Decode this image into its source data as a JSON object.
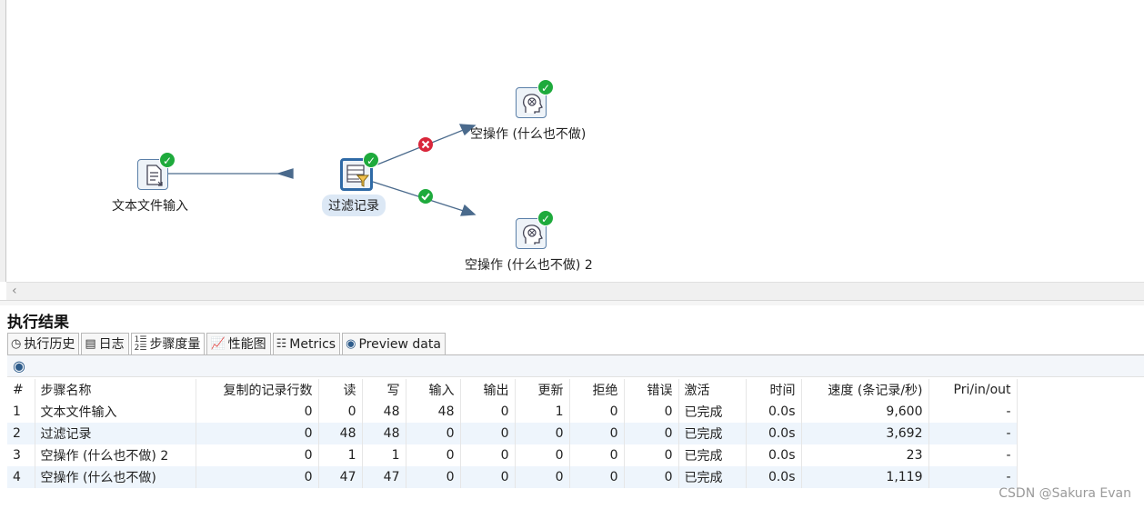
{
  "canvas": {
    "steps": [
      {
        "label": "文本文件输入",
        "status": "ok"
      },
      {
        "label": "过滤记录",
        "status": "ok"
      },
      {
        "label": "空操作 (什么也不做)",
        "status": "ok"
      },
      {
        "label": "空操作 (什么也不做) 2",
        "status": "ok"
      }
    ],
    "hops": [
      {
        "from": "文本文件输入",
        "to": "过滤记录",
        "type": "normal"
      },
      {
        "from": "过滤记录",
        "to": "空操作 (什么也不做)",
        "type": "false"
      },
      {
        "from": "过滤记录",
        "to": "空操作 (什么也不做) 2",
        "type": "true"
      }
    ]
  },
  "results": {
    "title": "执行结果",
    "tabs": [
      "执行历史",
      "日志",
      "步骤度量",
      "性能图",
      "Metrics",
      "Preview data"
    ],
    "active_tab": "步骤度量",
    "columns": [
      "#",
      "步骤名称",
      "复制的记录行数",
      "读",
      "写",
      "输入",
      "输出",
      "更新",
      "拒绝",
      "错误",
      "激活",
      "时间",
      "速度 (条记录/秒)",
      "Pri/in/out"
    ],
    "rows": [
      [
        "1",
        "文本文件输入",
        "0",
        "0",
        "48",
        "48",
        "0",
        "1",
        "0",
        "0",
        "已完成",
        "0.0s",
        "9,600",
        "-"
      ],
      [
        "2",
        "过滤记录",
        "0",
        "48",
        "48",
        "0",
        "0",
        "0",
        "0",
        "0",
        "已完成",
        "0.0s",
        "3,692",
        "-"
      ],
      [
        "3",
        "空操作 (什么也不做) 2",
        "0",
        "1",
        "1",
        "0",
        "0",
        "0",
        "0",
        "0",
        "已完成",
        "0.0s",
        "23",
        "-"
      ],
      [
        "4",
        "空操作 (什么也不做)",
        "0",
        "47",
        "47",
        "0",
        "0",
        "0",
        "0",
        "0",
        "已完成",
        "0.0s",
        "1,119",
        "-"
      ]
    ]
  },
  "watermark": "CSDN @Sakura Evan",
  "colors": {
    "ok": "#1eaa3c",
    "error": "#d9263a",
    "hop": "#4a6a8c",
    "selected": "#2f6aa6",
    "row_alt": "#eef5fc"
  }
}
